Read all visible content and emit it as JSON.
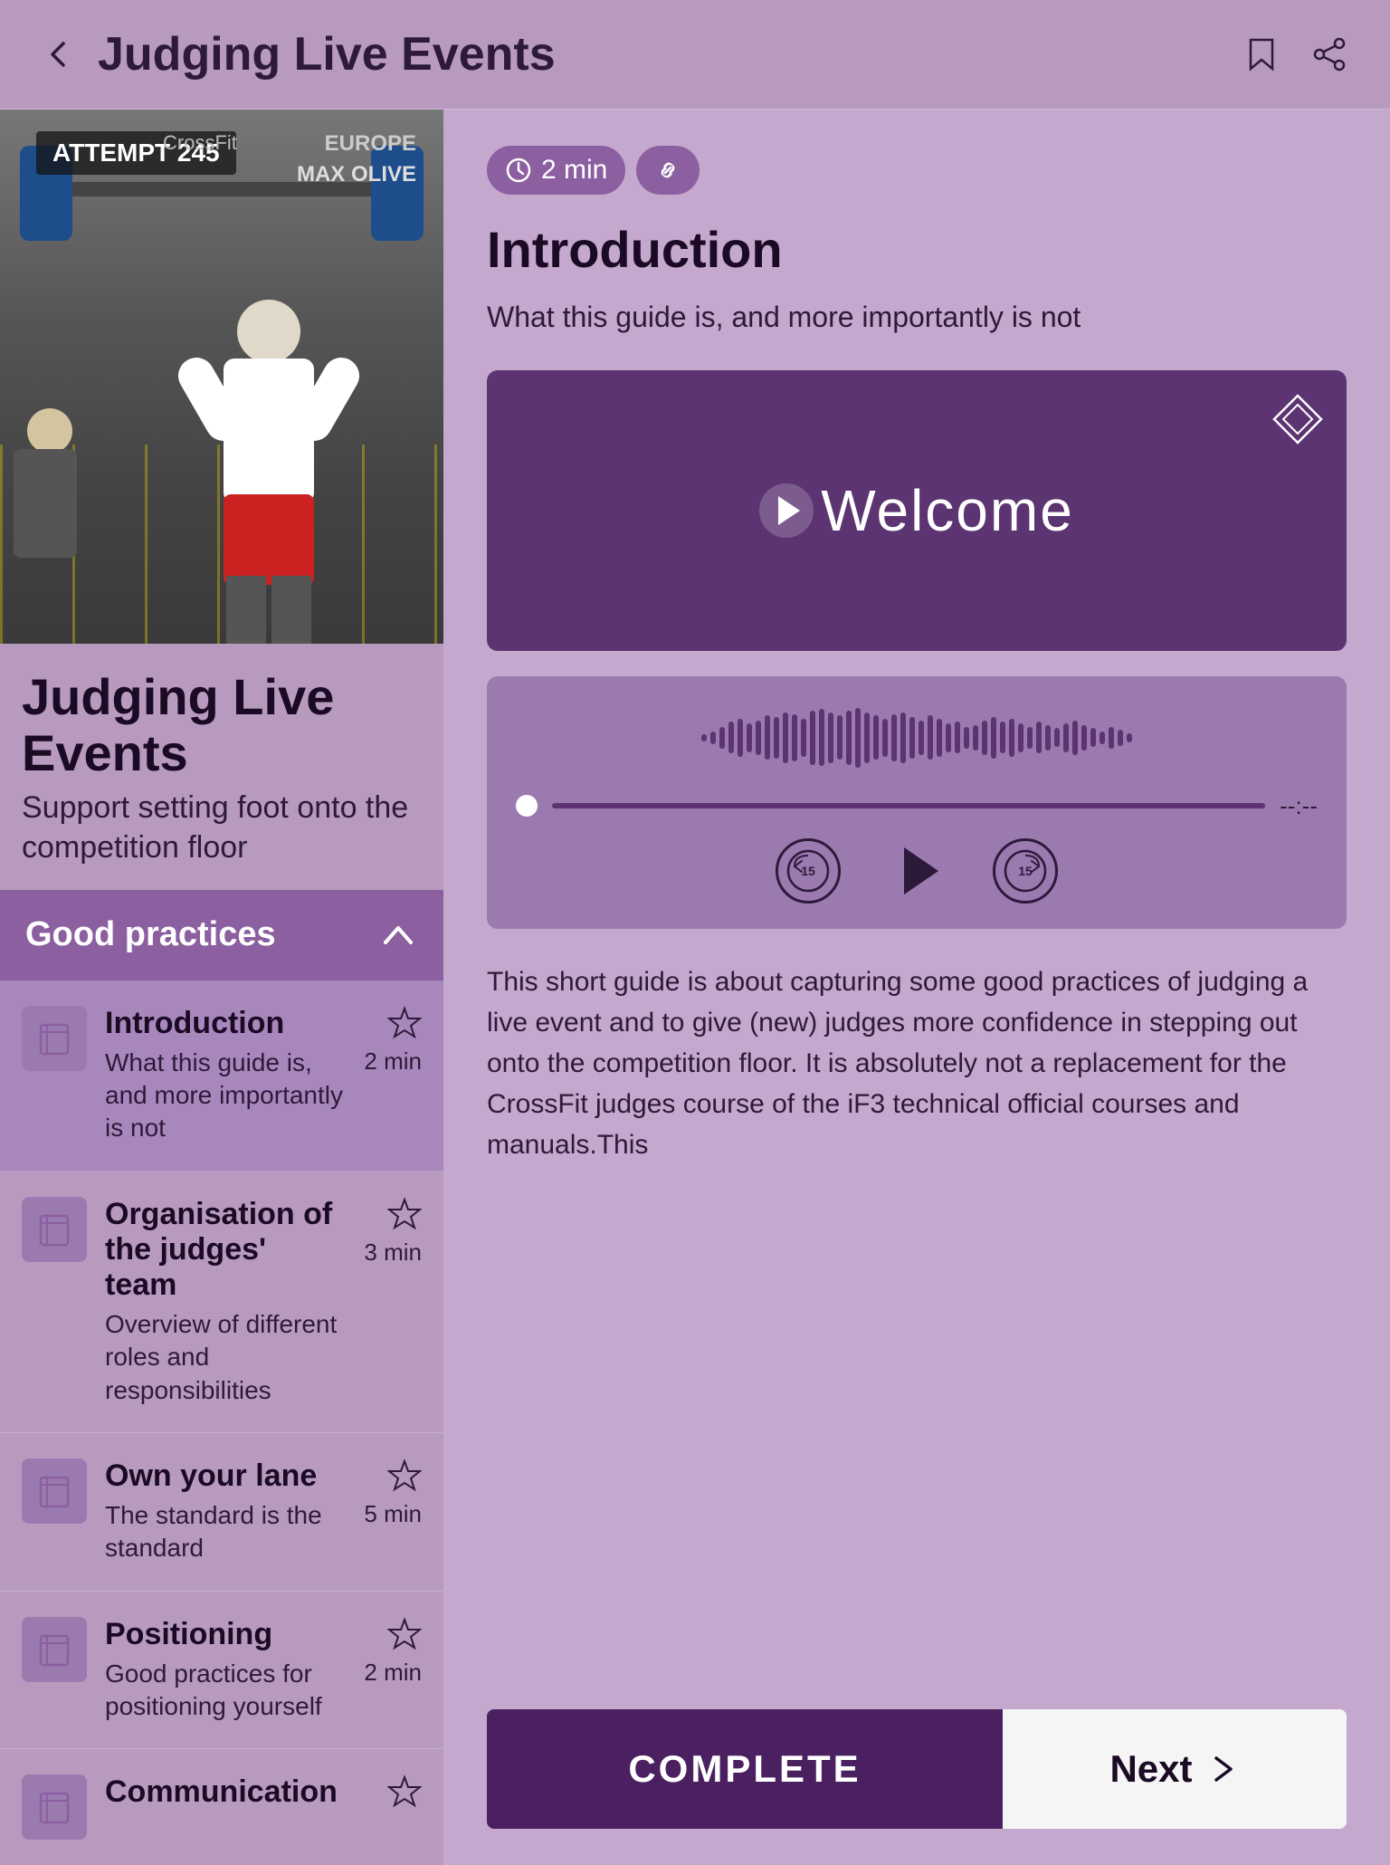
{
  "header": {
    "title": "Judging Live Events",
    "back_label": "‹"
  },
  "course": {
    "title": "Judging Live Events",
    "subtitle": "Support setting foot onto the competition floor",
    "hero_alt": "CrossFit competition floor with athlete overhead press"
  },
  "section": {
    "label": "Good practices",
    "expanded": true
  },
  "lessons": [
    {
      "id": "introduction",
      "title": "Introduction",
      "description": "What this guide is, and more importantly is not",
      "time": "2 min",
      "active": true
    },
    {
      "id": "organisation",
      "title": "Organisation of the judges' team",
      "description": "Overview of different roles and responsibilities",
      "time": "3 min",
      "active": false
    },
    {
      "id": "own-lane",
      "title": "Own your lane",
      "description": "The standard is the standard",
      "time": "5 min",
      "active": false
    },
    {
      "id": "positioning",
      "title": "Positioning",
      "description": "Good practices for positioning yourself",
      "time": "2 min",
      "active": false
    },
    {
      "id": "communication",
      "title": "Communication",
      "description": "",
      "time": "",
      "active": false
    }
  ],
  "content": {
    "time": "2 min",
    "title": "Introduction",
    "description": "What this guide is, and more importantly is not",
    "video_title": "Welcome",
    "body_text": "This short guide is about capturing some good practices of judging a live event and to give (new) judges more confidence in stepping out onto the competition floor. It is absolutely not a replacement for the CrossFit judges course of the iF3 technical official courses and manuals.This",
    "time_remaining": "--:--",
    "audio_progress": 0
  },
  "buttons": {
    "complete": "COMPLETE",
    "next": "Next"
  },
  "icons": {
    "clock": "⏱",
    "link": "🔗",
    "star": "☆",
    "back_arrow": "‹",
    "bookmark": "☆",
    "share": "⟳",
    "chevron_up": "∧",
    "play": "▶",
    "rewind_label": "15",
    "forward_label": "15",
    "next_arrow": "›"
  },
  "colors": {
    "background": "#b89abf",
    "left_panel_bg": "#b89abf",
    "right_panel_bg": "#c4a8cd",
    "section_bg": "#8b5fa0",
    "video_bg": "#5c3472",
    "audio_bg": "#9b7ab0",
    "complete_btn": "#4a2060",
    "next_btn": "#f5f5f5",
    "dark_text": "#1a0a24",
    "medium_text": "#2d1a3a"
  },
  "wave_bars": [
    12,
    20,
    35,
    50,
    60,
    45,
    55,
    70,
    65,
    80,
    75,
    60,
    85,
    90,
    80,
    70,
    85,
    95,
    80,
    70,
    60,
    75,
    80,
    65,
    55,
    70,
    60,
    45,
    50,
    35,
    40,
    55,
    65,
    50,
    60,
    45,
    35,
    50,
    40,
    30,
    45,
    55,
    40,
    30,
    20,
    35,
    25,
    15
  ]
}
